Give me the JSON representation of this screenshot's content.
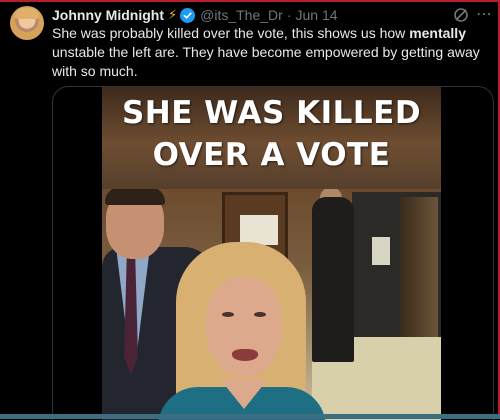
{
  "post": {
    "author_name": "Johnny Midnight",
    "author_emoji": "⚡",
    "handle": "@its_The_Dr",
    "separator": "·",
    "date": "Jun 14",
    "text_part1": "She was probably killed over the vote, this shows us how ",
    "text_bold": "mentally",
    "text_part2": " unstable the left are. They have become empowered by getting away with so much."
  },
  "media": {
    "caption_line1": "SHE WAS KILLED",
    "caption_line2": "OVER A VOTE"
  },
  "icons": {
    "verified": "verified-badge-icon",
    "grok": "grok-icon",
    "more": "more-options-icon"
  },
  "colors": {
    "verified_blue": "#1d9bf0",
    "frame_red": "#b3202c",
    "secondary_text": "#71767b"
  }
}
